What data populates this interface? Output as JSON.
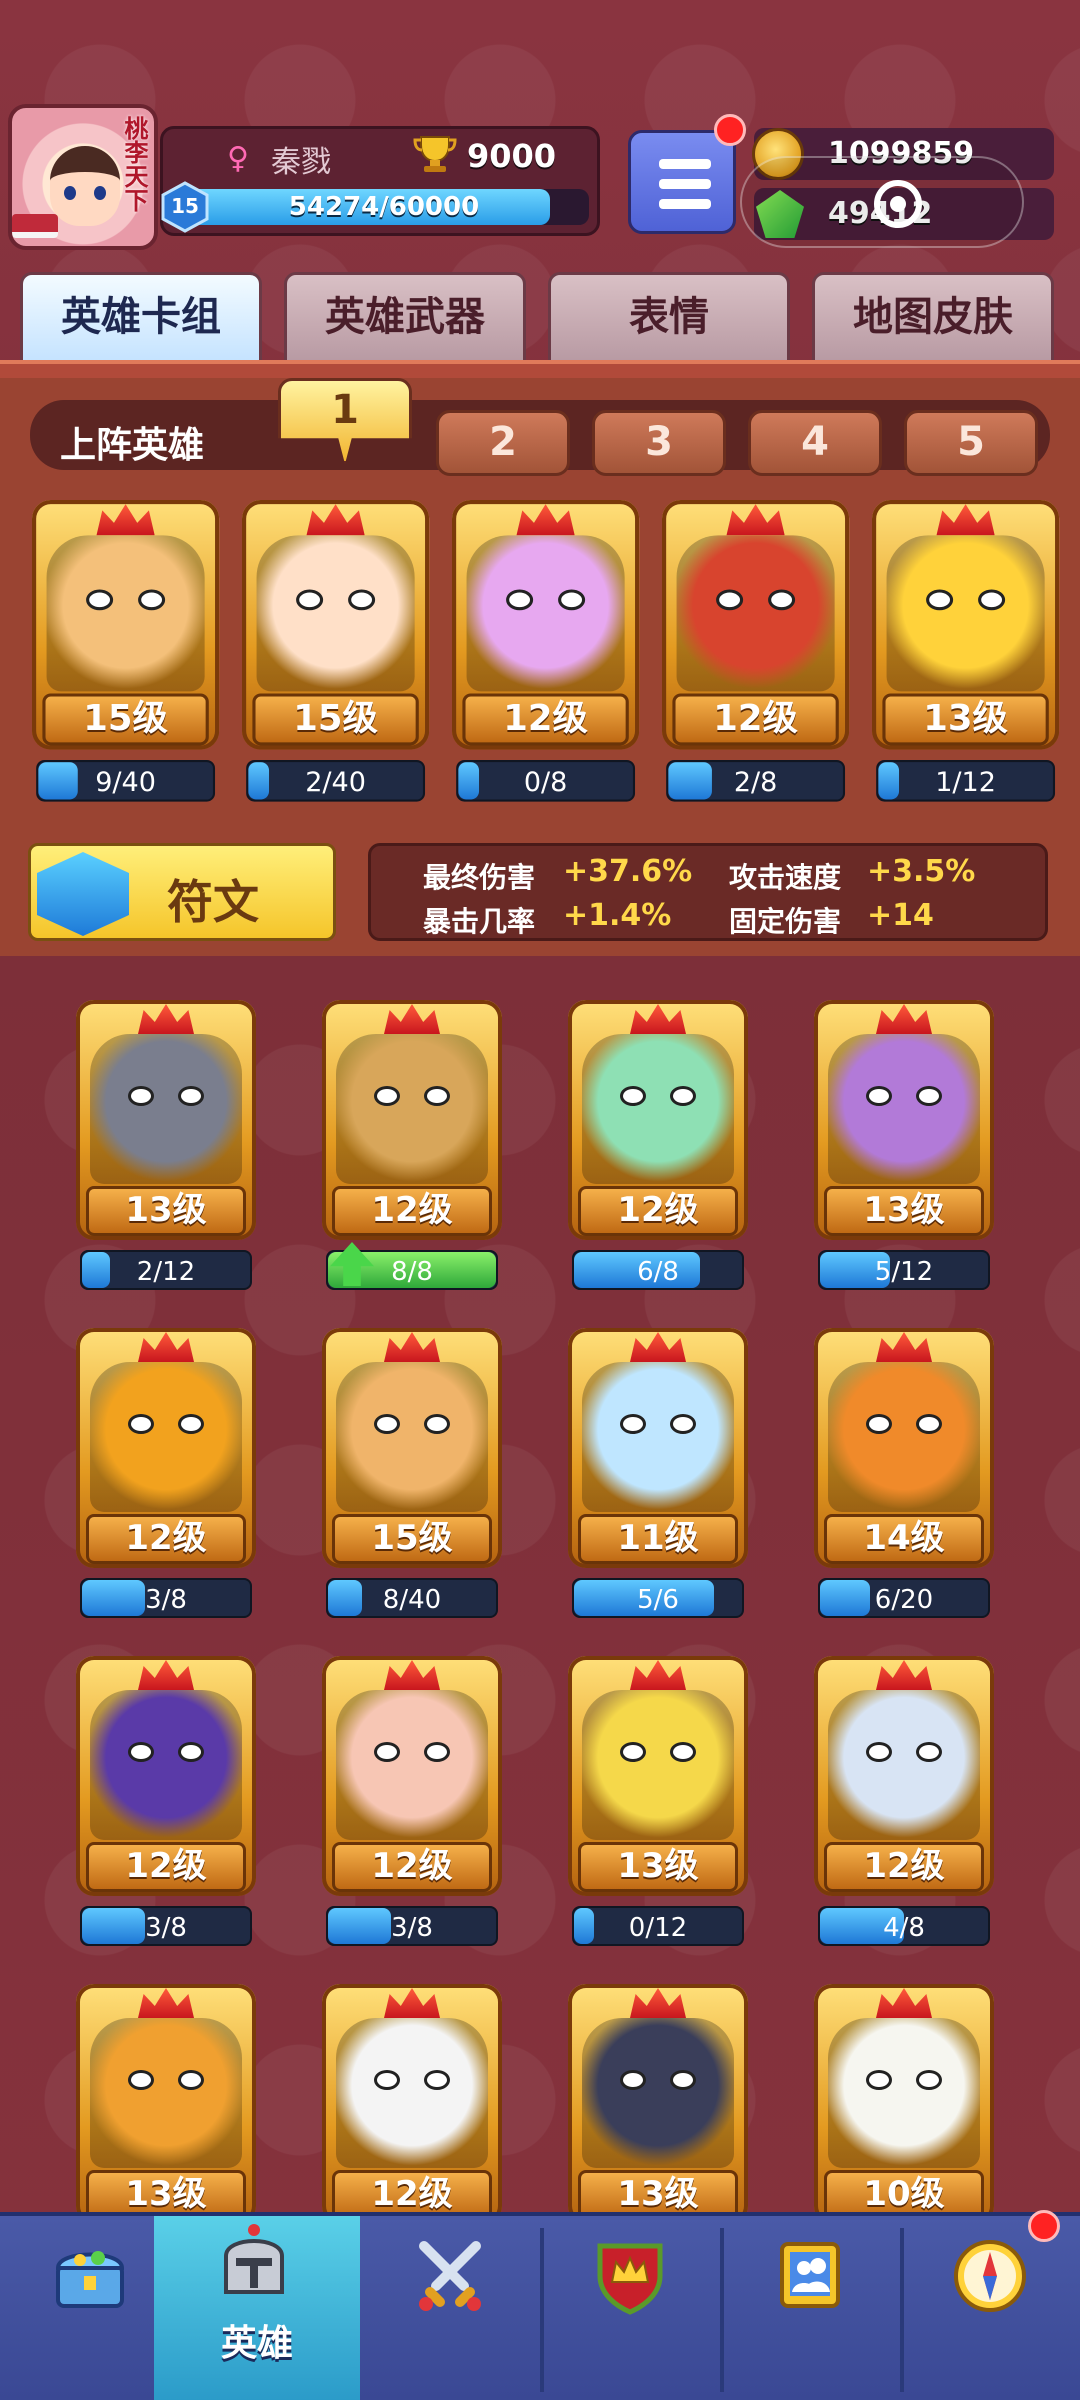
{
  "header": {
    "player_name": "秦戮",
    "trophies": "9000",
    "player_level": "15",
    "xp_text": "54274/60000",
    "xp_fraction": 0.9046,
    "avatar_title": "桃李天下",
    "gold": "1099859",
    "gems": "49412",
    "icons": {
      "gender": "female-icon",
      "trophy": "trophy-icon",
      "menu": "hamburger-menu-icon",
      "gold": "coin-icon",
      "gems": "gem-icon"
    }
  },
  "tabs": [
    {
      "label": "英雄卡组",
      "active": true
    },
    {
      "label": "英雄武器",
      "active": false
    },
    {
      "label": "表情",
      "active": false
    },
    {
      "label": "地图皮肤",
      "active": false
    }
  ],
  "lineup": {
    "label": "上阵英雄",
    "slots": [
      "1",
      "2",
      "3",
      "4",
      "5"
    ],
    "active_slot": "1",
    "heroes": [
      {
        "level": "15级",
        "progress": "9/40",
        "fraction": 0.225,
        "color": "#f4c07a"
      },
      {
        "level": "15级",
        "progress": "2/40",
        "fraction": 0.05,
        "color": "#ffe0c8"
      },
      {
        "level": "12级",
        "progress": "0/8",
        "fraction": 0.0,
        "color": "#e7a8f0"
      },
      {
        "level": "12级",
        "progress": "2/8",
        "fraction": 0.25,
        "color": "#d8442e"
      },
      {
        "level": "13级",
        "progress": "1/12",
        "fraction": 0.083,
        "color": "#ffd23a"
      }
    ]
  },
  "runes": {
    "label": "符文",
    "stats": [
      {
        "name": "最终伤害",
        "value": "+37.6%"
      },
      {
        "name": "攻击速度",
        "value": "+3.5%"
      },
      {
        "name": "暴击几率",
        "value": "+1.4%"
      },
      {
        "name": "固定伤害",
        "value": "+14"
      }
    ]
  },
  "collection": [
    {
      "level": "13级",
      "progress": "2/12",
      "fraction": 0.167,
      "color": "#7a7e8e",
      "upgradable": false
    },
    {
      "level": "12级",
      "progress": "8/8",
      "fraction": 1.0,
      "color": "#d8a65a",
      "upgradable": true
    },
    {
      "level": "12级",
      "progress": "6/8",
      "fraction": 0.75,
      "color": "#8ee0b4",
      "upgradable": false
    },
    {
      "level": "13级",
      "progress": "5/12",
      "fraction": 0.417,
      "color": "#b27ad8",
      "upgradable": false
    },
    {
      "level": "12级",
      "progress": "3/8",
      "fraction": 0.375,
      "color": "#f2a21e",
      "upgradable": false
    },
    {
      "level": "15级",
      "progress": "8/40",
      "fraction": 0.2,
      "color": "#f0b46a",
      "upgradable": false
    },
    {
      "level": "11级",
      "progress": "5/6",
      "fraction": 0.833,
      "color": "#bfe6ff",
      "upgradable": false
    },
    {
      "level": "14级",
      "progress": "6/20",
      "fraction": 0.3,
      "color": "#f08a2a",
      "upgradable": false
    },
    {
      "level": "12级",
      "progress": "3/8",
      "fraction": 0.375,
      "color": "#5a3aa8",
      "upgradable": false
    },
    {
      "level": "12级",
      "progress": "3/8",
      "fraction": 0.375,
      "color": "#f7c6b4",
      "upgradable": false
    },
    {
      "level": "13级",
      "progress": "0/12",
      "fraction": 0.0,
      "color": "#f5d84a",
      "upgradable": false
    },
    {
      "level": "12级",
      "progress": "4/8",
      "fraction": 0.5,
      "color": "#d8e4f4",
      "upgradable": false
    },
    {
      "level": "13级",
      "progress": "",
      "fraction": 0.0,
      "color": "#f0a030",
      "upgradable": false
    },
    {
      "level": "12级",
      "progress": "",
      "fraction": 0.0,
      "color": "#f4f4f4",
      "upgradable": false
    },
    {
      "level": "13级",
      "progress": "",
      "fraction": 0.0,
      "color": "#3a3e5a",
      "upgradable": false
    },
    {
      "level": "10级",
      "progress": "",
      "fraction": 0.0,
      "color": "#f6f6f0",
      "upgradable": false
    }
  ],
  "bottom_nav": [
    {
      "label": "",
      "icon": "treasure-chest-icon",
      "active": false,
      "badge": false
    },
    {
      "label": "英雄",
      "icon": "knight-helmet-icon",
      "active": true,
      "badge": false
    },
    {
      "label": "",
      "icon": "crossed-swords-icon",
      "active": false,
      "badge": false
    },
    {
      "label": "",
      "icon": "crown-shield-icon",
      "active": false,
      "badge": false
    },
    {
      "label": "",
      "icon": "guild-banner-icon",
      "active": false,
      "badge": false
    },
    {
      "label": "",
      "icon": "compass-icon",
      "active": false,
      "badge": true
    }
  ]
}
